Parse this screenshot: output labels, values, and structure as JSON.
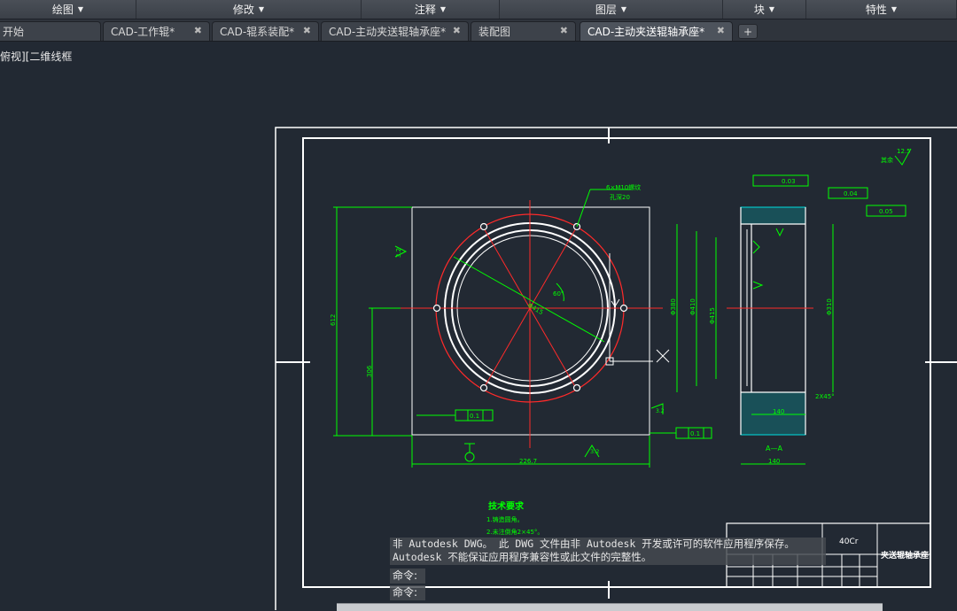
{
  "ribbon": {
    "panels": [
      {
        "label": "绘图"
      },
      {
        "label": "修改"
      },
      {
        "label": "注释"
      },
      {
        "label": "图层"
      },
      {
        "label": "块"
      },
      {
        "label": "特性"
      }
    ]
  },
  "tabs": [
    {
      "label": "开始",
      "closable": false
    },
    {
      "label": "CAD-工作辊*",
      "closable": true
    },
    {
      "label": "CAD-辊系装配*",
      "closable": true
    },
    {
      "label": "CAD-主动夹送辊轴承座*",
      "closable": true
    },
    {
      "label": "装配图",
      "closable": true
    },
    {
      "label": "CAD-主动夹送辊轴承座*",
      "closable": true,
      "active": true
    }
  ],
  "tab_add": "+",
  "viewport": {
    "label": "俯视][二维线框"
  },
  "drawing": {
    "tech_title": "技术要求",
    "tech_notes": [
      "1.铸造圆角。",
      "2.未注倒角2×45°。"
    ],
    "hole_note_1": "6×M10螺纹",
    "hole_note_2": "孔深20",
    "roughness_note": "其余",
    "roughness_value": "12.5",
    "section_label": "A—A",
    "material": "40Cr",
    "part_name": "夹送辊轴承座",
    "dims": {
      "width": "226.7",
      "height": "612",
      "half_height": "306",
      "angle": "60°",
      "circle_dia": "Φ415",
      "bore": "Φ380",
      "bore2": "Φ410",
      "bore3": "Φ415",
      "bore4": "Φ310",
      "section_w1": "140",
      "section_w2": "140",
      "chamfer": "2X45°",
      "side_roughness": "3.2"
    },
    "tolerances": {
      "t1": "0.03",
      "t2": "0.04",
      "t3": "0.05",
      "t4": "0.1",
      "t5": "0.1"
    }
  },
  "command": {
    "message_line1": "非 Autodesk DWG。  此 DWG 文件由非 Autodesk 开发或许可的软件应用程序保存。",
    "message_line2": "Autodesk 不能保证应用程序兼容性或此文件的完整性。",
    "prompt1": "命令:",
    "prompt2": "命令:"
  }
}
